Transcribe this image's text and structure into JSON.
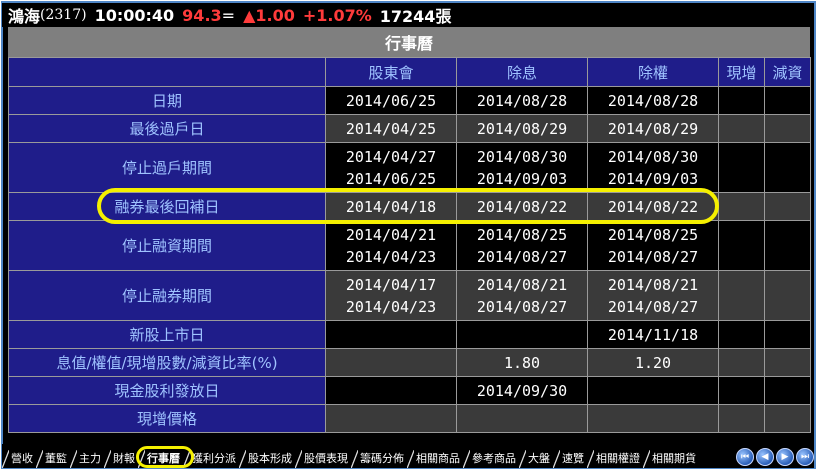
{
  "quote": {
    "name": "鴻海",
    "code": "(2317)",
    "time": "10:00:40",
    "price": "94.3",
    "eq": "=",
    "change": "▲1.00",
    "percent": "+1.07%",
    "volume": "17244張"
  },
  "title": "行事曆",
  "columns": [
    "股東會",
    "除息",
    "除權",
    "現增",
    "減資"
  ],
  "rows": [
    {
      "label": "日期",
      "cells": [
        [
          "2014/06/25"
        ],
        [
          "2014/08/28"
        ],
        [
          "2014/08/28"
        ],
        [],
        []
      ]
    },
    {
      "label": "最後過戶日",
      "cells": [
        [
          "2014/04/25"
        ],
        [
          "2014/08/29"
        ],
        [
          "2014/08/29"
        ],
        [],
        []
      ]
    },
    {
      "label": "停止過戶期間",
      "cells": [
        [
          "2014/04/27",
          "2014/06/25"
        ],
        [
          "2014/08/30",
          "2014/09/03"
        ],
        [
          "2014/08/30",
          "2014/09/03"
        ],
        [],
        []
      ]
    },
    {
      "label": "融券最後回補日",
      "cells": [
        [
          "2014/04/18"
        ],
        [
          "2014/08/22"
        ],
        [
          "2014/08/22"
        ],
        [],
        []
      ]
    },
    {
      "label": "停止融資期間",
      "cells": [
        [
          "2014/04/21",
          "2014/04/23"
        ],
        [
          "2014/08/25",
          "2014/08/27"
        ],
        [
          "2014/08/25",
          "2014/08/27"
        ],
        [],
        []
      ]
    },
    {
      "label": "停止融券期間",
      "cells": [
        [
          "2014/04/17",
          "2014/04/23"
        ],
        [
          "2014/08/21",
          "2014/08/27"
        ],
        [
          "2014/08/21",
          "2014/08/27"
        ],
        [],
        []
      ]
    },
    {
      "label": "新股上市日",
      "cells": [
        [],
        [],
        [
          "2014/11/18"
        ],
        [],
        []
      ]
    },
    {
      "label": "息值/權值/現增股數/減資比率(%)",
      "cells": [
        [],
        [
          "1.80"
        ],
        [
          "1.20"
        ],
        [],
        []
      ]
    },
    {
      "label": "現金股利發放日",
      "cells": [
        [],
        [
          "2014/09/30"
        ],
        [],
        [],
        []
      ]
    },
    {
      "label": "現增價格",
      "cells": [
        [],
        [],
        [],
        [],
        []
      ]
    }
  ],
  "tabs": [
    "營收",
    "董監",
    "主力",
    "財報",
    "行事曆",
    "獲利分派",
    "股本形成",
    "股價表現",
    "籌碼分佈",
    "相關商品",
    "參考商品",
    "大盤",
    "速覽",
    "相關權證",
    "相關期貨"
  ],
  "active_tab": "行事曆",
  "nav_buttons": [
    "first-icon",
    "prev-icon",
    "next-icon",
    "last-icon"
  ],
  "colors": {
    "label_bg": "#1f1d8a",
    "label_text": "#9fc3ff",
    "up": "#ff3b3b",
    "highlight": "#f5f000"
  }
}
